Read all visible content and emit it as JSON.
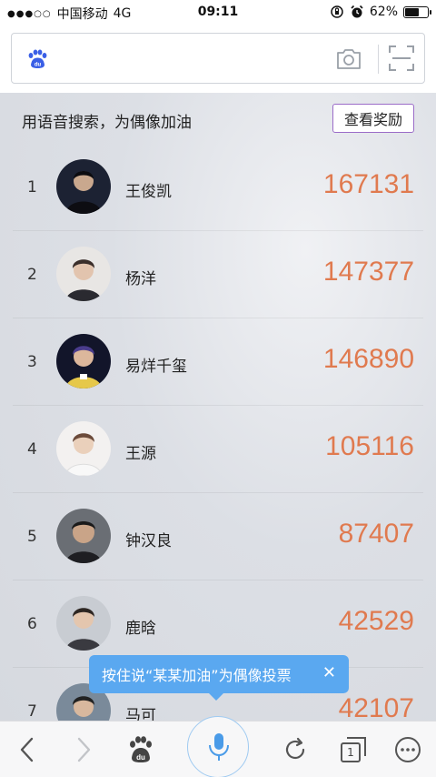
{
  "status_bar": {
    "signal_dots": "●●●○○",
    "carrier": "中国移动",
    "network": "4G",
    "time": "09:11",
    "battery_pct_label": "62%",
    "battery_level": 0.62
  },
  "search": {
    "placeholder": ""
  },
  "main": {
    "headline": "用语音搜索，为偶像加油",
    "reward_button": "查看奖励",
    "ranking": [
      {
        "rank": "1",
        "name": "王俊凯",
        "votes": "167131"
      },
      {
        "rank": "2",
        "name": "杨洋",
        "votes": "147377"
      },
      {
        "rank": "3",
        "name": "易烊千玺",
        "votes": "146890"
      },
      {
        "rank": "4",
        "name": "王源",
        "votes": "105116"
      },
      {
        "rank": "5",
        "name": "钟汉良",
        "votes": "87407"
      },
      {
        "rank": "6",
        "name": "鹿晗",
        "votes": "42529"
      },
      {
        "rank": "7",
        "name": "马可",
        "votes": "42107"
      }
    ]
  },
  "tooltip": {
    "text": "按住说“某某加油”为偶像投票",
    "close": "✕"
  },
  "toolbar": {
    "tabs_count": "1"
  },
  "colors": {
    "votes": "#e07a4f",
    "accent_blue": "#5aa8f0",
    "reward_border": "#9b6cc8"
  }
}
